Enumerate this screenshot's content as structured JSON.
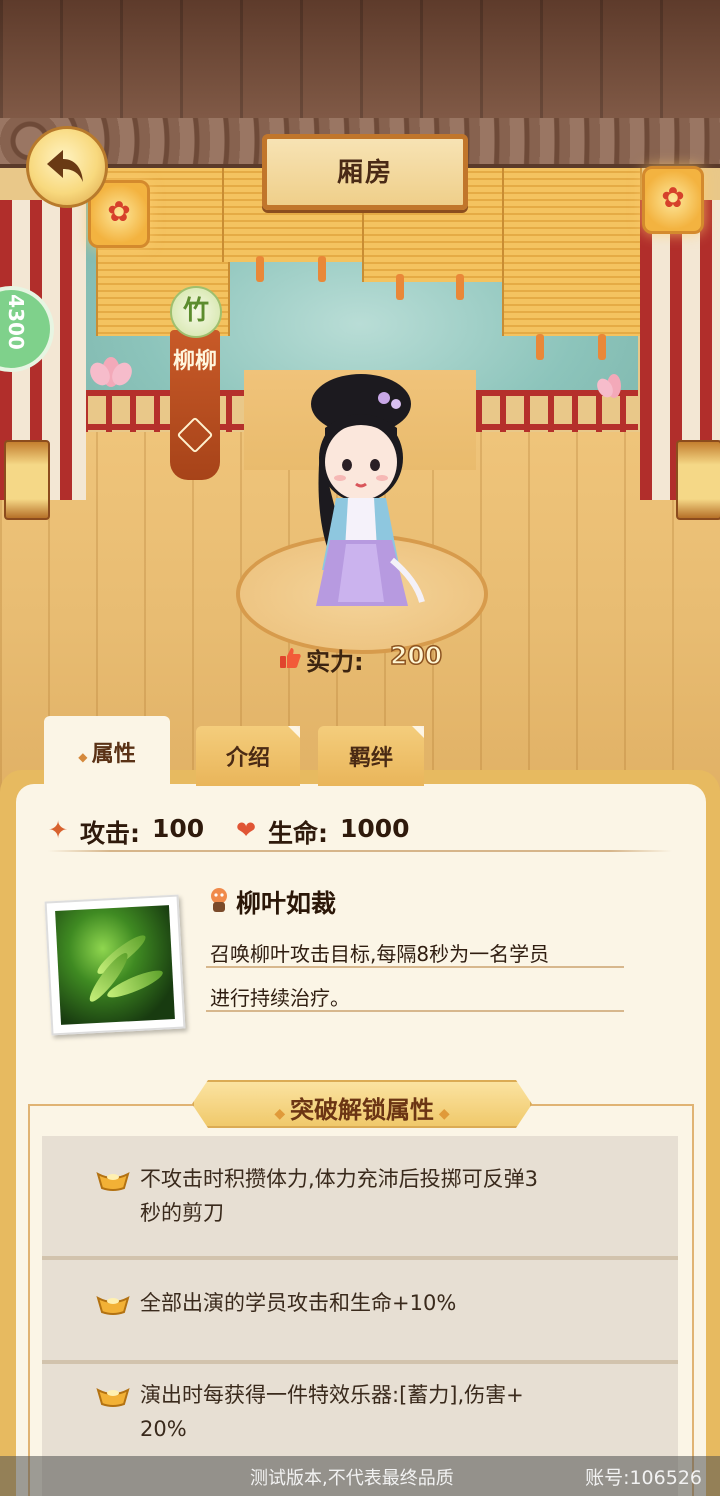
{
  "header": {
    "title": "厢房"
  },
  "side_badge": {
    "text": "4300"
  },
  "character": {
    "rank_char": "竹",
    "name": "柳柳"
  },
  "power": {
    "label": "实力:",
    "value": "200"
  },
  "tabs": [
    {
      "label": "属性",
      "active": true
    },
    {
      "label": "介绍",
      "active": false
    },
    {
      "label": "羁绊",
      "active": false
    }
  ],
  "stats": {
    "attack_label": "攻击:",
    "attack_value": "100",
    "hp_label": "生命:",
    "hp_value": "1000"
  },
  "skill": {
    "name": "柳叶如裁",
    "desc_line1": "召唤柳叶攻击目标,每隔8秒为一名学员",
    "desc_line2": "进行持续治疗。"
  },
  "breakthrough": {
    "title": "突破解锁属性",
    "items": [
      {
        "line1": "不攻击时积攒体力,体力充沛后投掷可反弹3",
        "line2": "秒的剪刀"
      },
      {
        "line1": "全部出演的学员攻击和生命+10%",
        "line2": ""
      },
      {
        "line1": "演出时每获得一件特效乐器:[蓄力],伤害+",
        "line2": "20%"
      }
    ]
  },
  "footer": {
    "watermark": "测试版本,不代表最终品质",
    "account": "账号:106526"
  },
  "colors": {
    "panel_bg": "#fbf5e6",
    "panel_border": "#e7ba60",
    "banner_red": "#b8491e",
    "text_dark": "#2f1a0c"
  }
}
